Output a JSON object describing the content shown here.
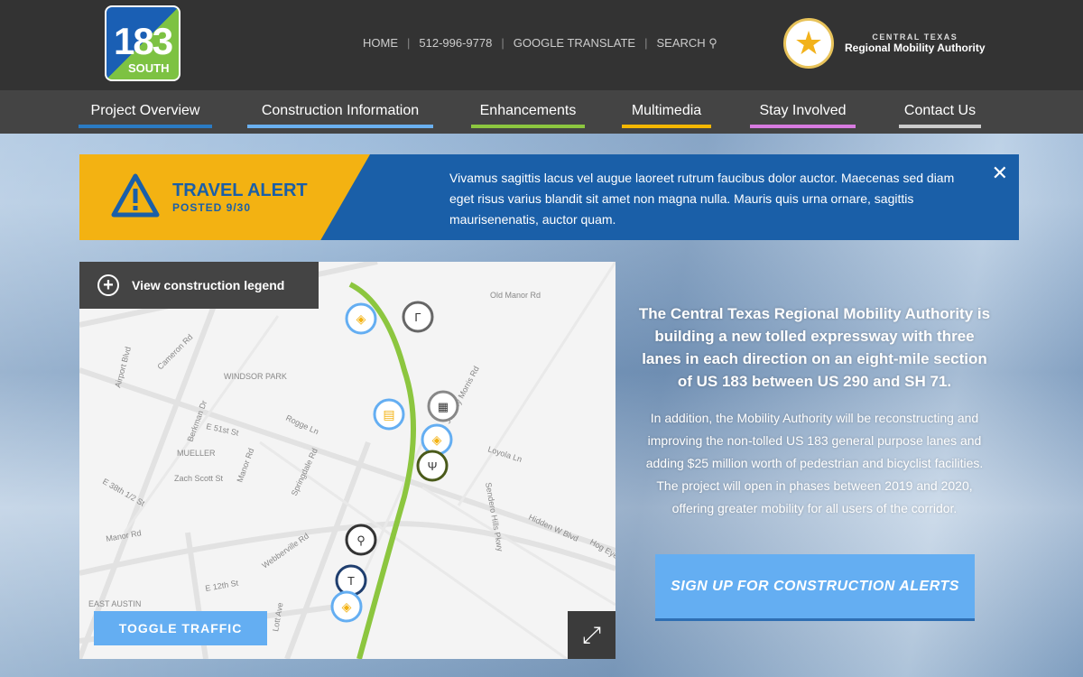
{
  "header": {
    "logo": {
      "number": "183",
      "word": "SOUTH"
    },
    "links": [
      "HOME",
      "512-996-9778",
      "GOOGLE TRANSLATE",
      "SEARCH"
    ],
    "org": {
      "line1": "CENTRAL TEXAS",
      "line2": "Regional Mobility Authority"
    }
  },
  "nav": [
    {
      "label": "Project  Overview",
      "color": "#2a7bc4"
    },
    {
      "label": "Construction  Information",
      "color": "#6ab0f0"
    },
    {
      "label": "Enhancements",
      "color": "#8cc63f"
    },
    {
      "label": "Multimedia",
      "color": "#f5b700"
    },
    {
      "label": "Stay  Involved",
      "color": "#d77be0"
    },
    {
      "label": "Contact  Us",
      "color": "#cccccc"
    }
  ],
  "alert": {
    "title": "TRAVEL ALERT",
    "posted": "POSTED 9/30",
    "message": "Vivamus sagittis lacus vel augue laoreet rutrum faucibus dolor auctor. Maecenas sed diam eget risus varius blandit sit amet non magna nulla. Mauris quis urna ornare, sagittis maurisenenatis, auctor quam.",
    "close": "✕"
  },
  "map": {
    "legend_label": "View construction legend",
    "toggle_label": "TOGGLE TRAFFIC",
    "labels": [
      "Old Manor Rd",
      "Cameron Rd",
      "Airport Blvd",
      "WINDSOR PARK",
      "Berkman Dr",
      "E 51st St",
      "Rogge Ln",
      "MUELLER",
      "Zach Scott St",
      "Manor Rd",
      "Springdale Rd",
      "Loyola Ln",
      "Johnny Morris Rd",
      "E 38th 1/2 St",
      "Hidden W Blvd",
      "Manor Rd",
      "Webberville Rd",
      "E 12th St",
      "EAST AUSTIN",
      "Lott Ave",
      "Hog Eye",
      "Sendero Hills Pkwy"
    ]
  },
  "intro": {
    "lead": "The Central Texas Regional Mobility Authority is building a new tolled expressway with three lanes in each direction on an eight-mile section of US 183 between US 290 and SH 71.",
    "body": "In addition, the Mobility Authority will be reconstructing and improving the non-tolled US 183 general purpose lanes and adding $25 million worth of pedestrian and bicyclist facilities. The project will open in phases between 2019 and 2020, offering greater mobility for all users of the corridor."
  },
  "signup": "SIGN UP FOR CONSTRUCTION ALERTS"
}
